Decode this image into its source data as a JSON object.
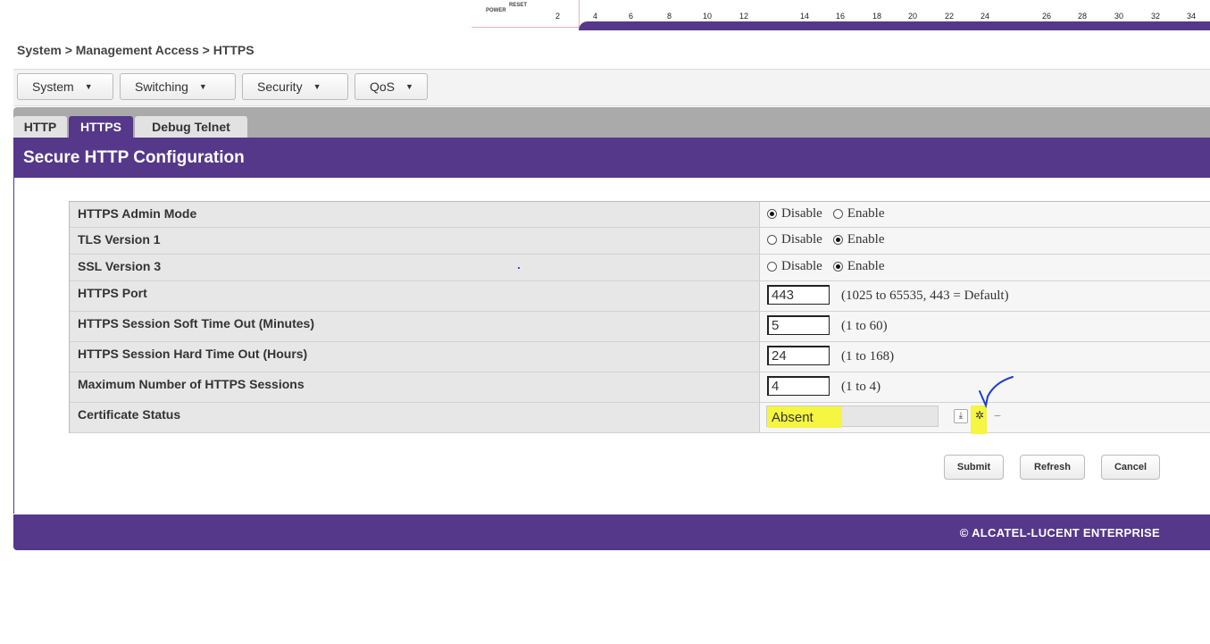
{
  "port_strip": {
    "power_label": "POWER",
    "reset_label": "RESET",
    "ports": [
      "2",
      "4",
      "6",
      "8",
      "10",
      "12",
      "14",
      "16",
      "18",
      "20",
      "22",
      "24",
      "26",
      "28",
      "30",
      "32",
      "34"
    ]
  },
  "breadcrumb": "System > Management Access > HTTPS",
  "menu": {
    "items": [
      "System",
      "Switching",
      "Security",
      "QoS"
    ]
  },
  "tabs": [
    {
      "label": "HTTP",
      "active": false
    },
    {
      "label": "HTTPS",
      "active": true
    },
    {
      "label": "Debug Telnet",
      "active": false
    }
  ],
  "section_title": "Secure HTTP Configuration",
  "rows": {
    "admin_mode": {
      "label": "HTTPS Admin Mode",
      "disable": "Disable",
      "enable": "Enable",
      "selected": "Disable"
    },
    "tls": {
      "label": "TLS Version 1",
      "disable": "Disable",
      "enable": "Enable",
      "selected": "Enable"
    },
    "ssl": {
      "label": "SSL Version 3",
      "disable": "Disable",
      "enable": "Enable",
      "selected": "Enable"
    },
    "port": {
      "label": "HTTPS Port",
      "value": "443",
      "hint": "(1025 to 65535, 443 = Default)"
    },
    "soft_timeout": {
      "label": "HTTPS Session Soft Time Out  (Minutes)",
      "value": "5",
      "hint": "(1 to 60)"
    },
    "hard_timeout": {
      "label": "HTTPS Session Hard Time Out  (Hours)",
      "value": "24",
      "hint": "(1 to 168)"
    },
    "max_sessions": {
      "label": "Maximum Number of HTTPS Sessions",
      "value": "4",
      "hint": "(1 to 4)"
    },
    "cert_status": {
      "label": "Certificate Status",
      "value": "Absent"
    }
  },
  "icons": {
    "download": "download-icon",
    "gear": "gear-icon",
    "remove": "minus-icon"
  },
  "buttons": {
    "submit": "Submit",
    "refresh": "Refresh",
    "cancel": "Cancel"
  },
  "footer": "© ALCATEL-LUCENT ENTERPRISE",
  "colors": {
    "brand_purple": "#55388a",
    "highlight": "#f5f542",
    "annotation_blue": "#1a3fd6"
  }
}
